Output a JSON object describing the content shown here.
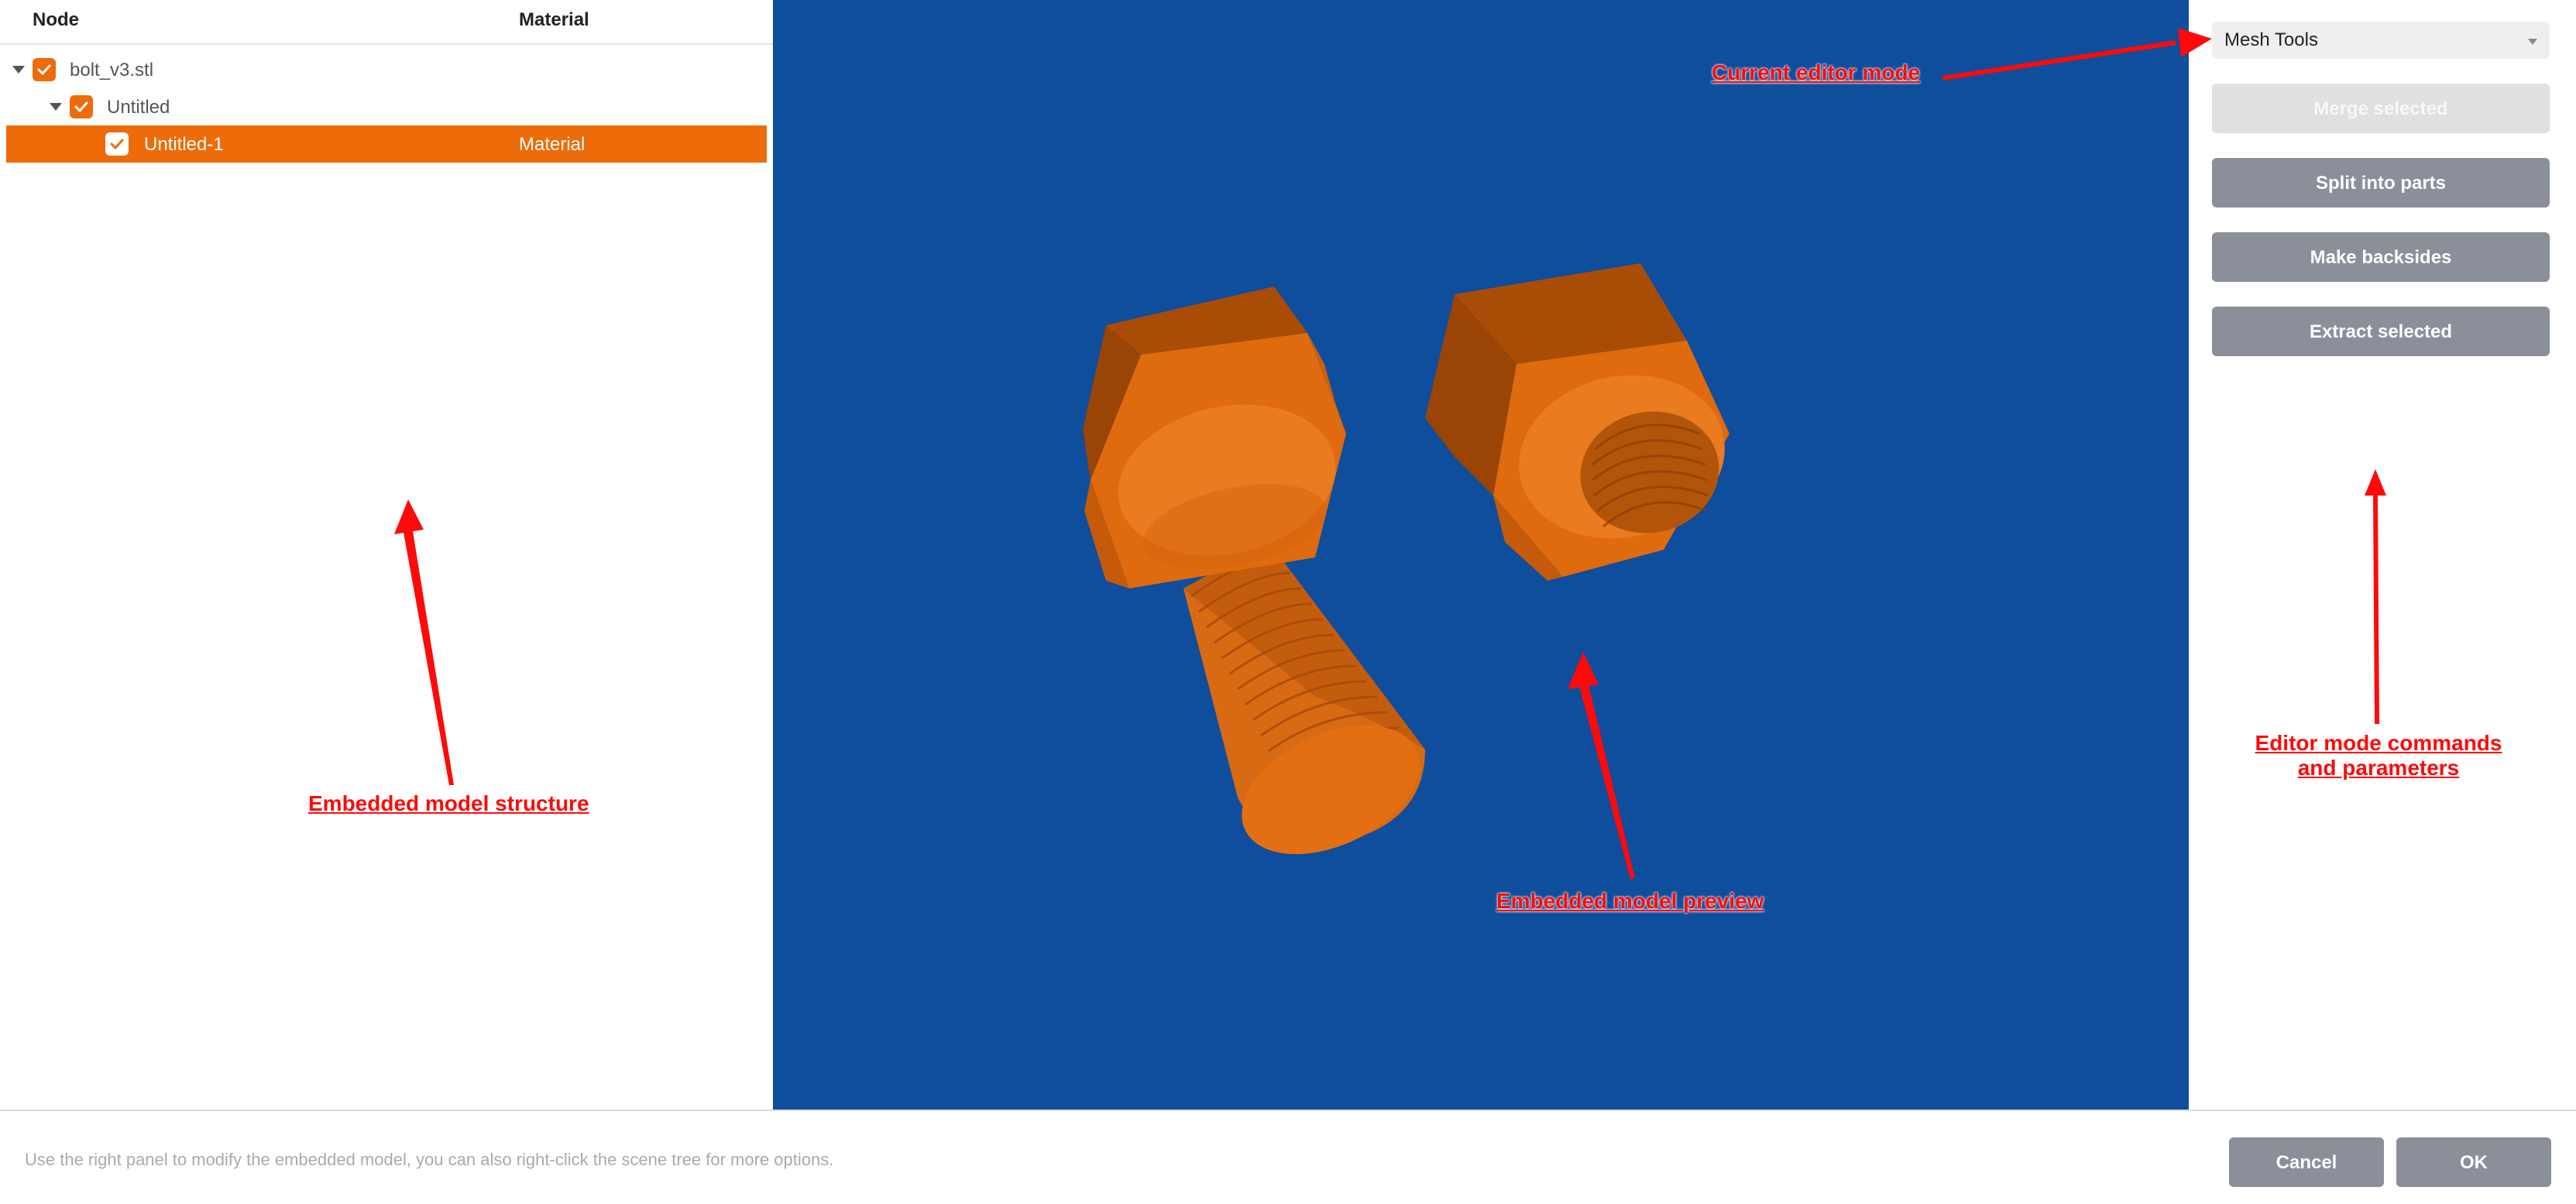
{
  "tree": {
    "header": {
      "node": "Node",
      "material": "Material"
    },
    "rows": [
      {
        "label": "bolt_v3.stl",
        "material": ""
      },
      {
        "label": "Untitled",
        "material": ""
      },
      {
        "label": "Untitled-1",
        "material": "Material"
      }
    ]
  },
  "right_panel": {
    "mode": "Mesh Tools",
    "buttons": {
      "merge": "Merge selected",
      "split": "Split into parts",
      "backsides": "Make backsides",
      "extract": "Extract selected"
    }
  },
  "footer": {
    "hint": "Use the right panel to modify the embedded model, you can also right-click the scene tree for more options.",
    "cancel": "Cancel",
    "ok": "OK"
  },
  "annotations": {
    "model_structure": "Embedded model structure",
    "model_preview": "Embedded model preview",
    "editor_mode": "Current editor mode",
    "mode_commands_line1": "Editor mode commands",
    "mode_commands_line2": "and parameters"
  },
  "colors": {
    "accent": "#ee6b0a",
    "viewport_bg": "#0f4d9d",
    "button_bg": "#8a8f99",
    "annotation": "#ff0a0a"
  }
}
